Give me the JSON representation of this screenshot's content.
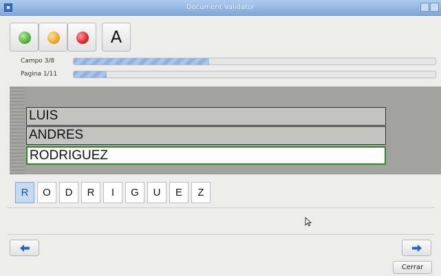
{
  "window": {
    "title": "Document Validator"
  },
  "toolbar": {
    "font_button_label": "A"
  },
  "progress": [
    {
      "label": "Campo 3/8",
      "fraction": 0.375
    },
    {
      "label": "Pagina 1/11",
      "fraction": 0.0909
    }
  ],
  "fields": [
    {
      "value": "LUIS",
      "active": false
    },
    {
      "value": "ANDRES",
      "active": false
    },
    {
      "value": "RODRIGUEZ",
      "active": true
    }
  ],
  "characters": [
    "R",
    "O",
    "D",
    "R",
    "I",
    "G",
    "U",
    "E",
    "Z"
  ],
  "selected_character_index": 0,
  "buttons": {
    "close_label": "Cerrar"
  },
  "colors": {
    "accent": "#7fa7d9",
    "active_field_border": "#2a8a2a"
  }
}
